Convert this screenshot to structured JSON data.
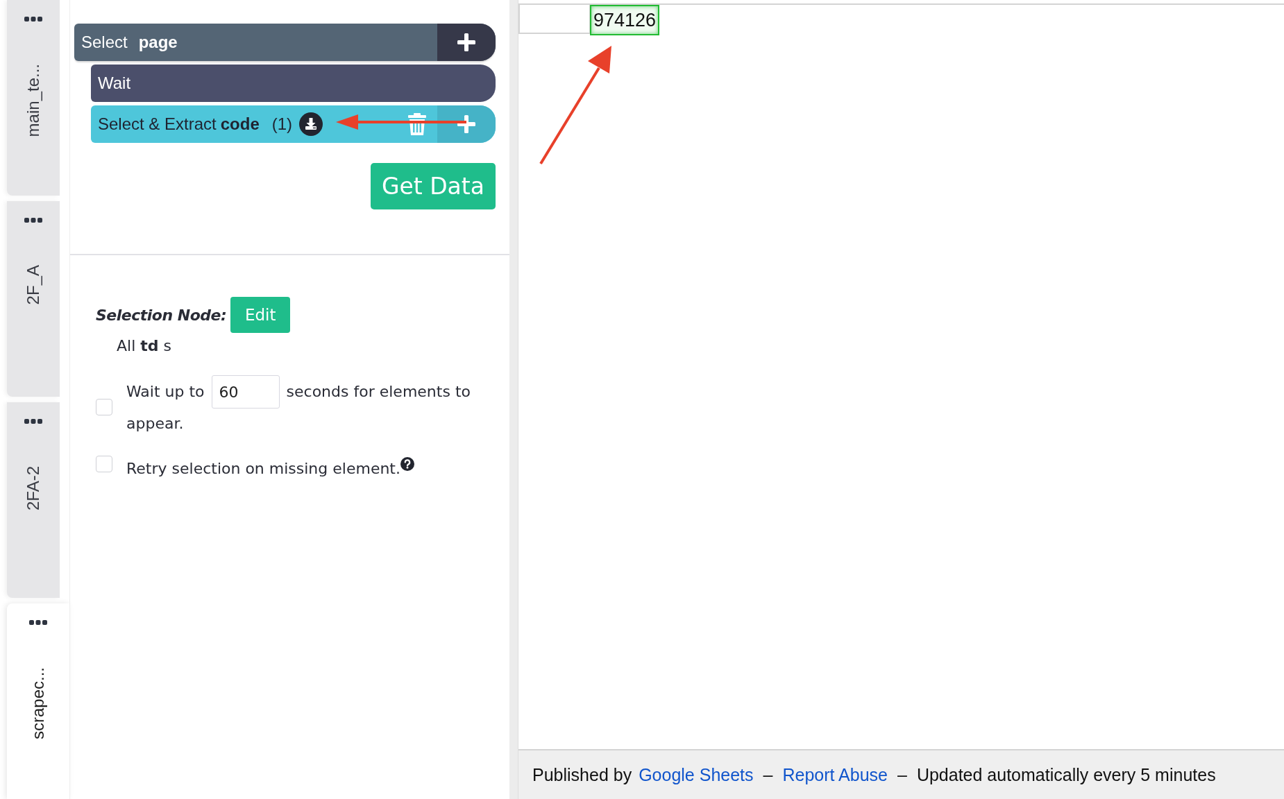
{
  "tabs": [
    {
      "label": "main_te...",
      "selected": false
    },
    {
      "label": "2F_A",
      "selected": false
    },
    {
      "label": "2FA-2",
      "selected": false
    },
    {
      "label": "scrapec...",
      "selected": true
    }
  ],
  "commands": [
    {
      "kind": "select",
      "label": "Select",
      "target": "page"
    },
    {
      "kind": "wait",
      "label": "Wait"
    },
    {
      "kind": "extract",
      "label": "Select & Extract",
      "target": "code",
      "count": "(1)"
    }
  ],
  "get_data_button": "Get Data",
  "selection_node": {
    "label": "Selection Node:",
    "edit_button": "Edit",
    "description": "All **td** s"
  },
  "options": [
    {
      "kind": "wait",
      "checked": false,
      "before": "Wait up to",
      "value": "60",
      "after": "seconds for elements to",
      "after_wrapped": "appear."
    },
    {
      "kind": "retry",
      "checked": false,
      "label": "Retry selection on missing element."
    }
  ],
  "sheet": {
    "cell": {
      "value": "974126",
      "highlighted": true
    }
  },
  "footer": [
    {
      "kind": "text",
      "text": "Published by"
    },
    {
      "kind": "link",
      "text": "Google Sheets"
    },
    {
      "kind": "sep",
      "text": "–"
    },
    {
      "kind": "link",
      "text": "Report Abuse"
    },
    {
      "kind": "sep",
      "text": "–"
    },
    {
      "kind": "text",
      "text": "Updated automatically every 5 minutes"
    }
  ]
}
